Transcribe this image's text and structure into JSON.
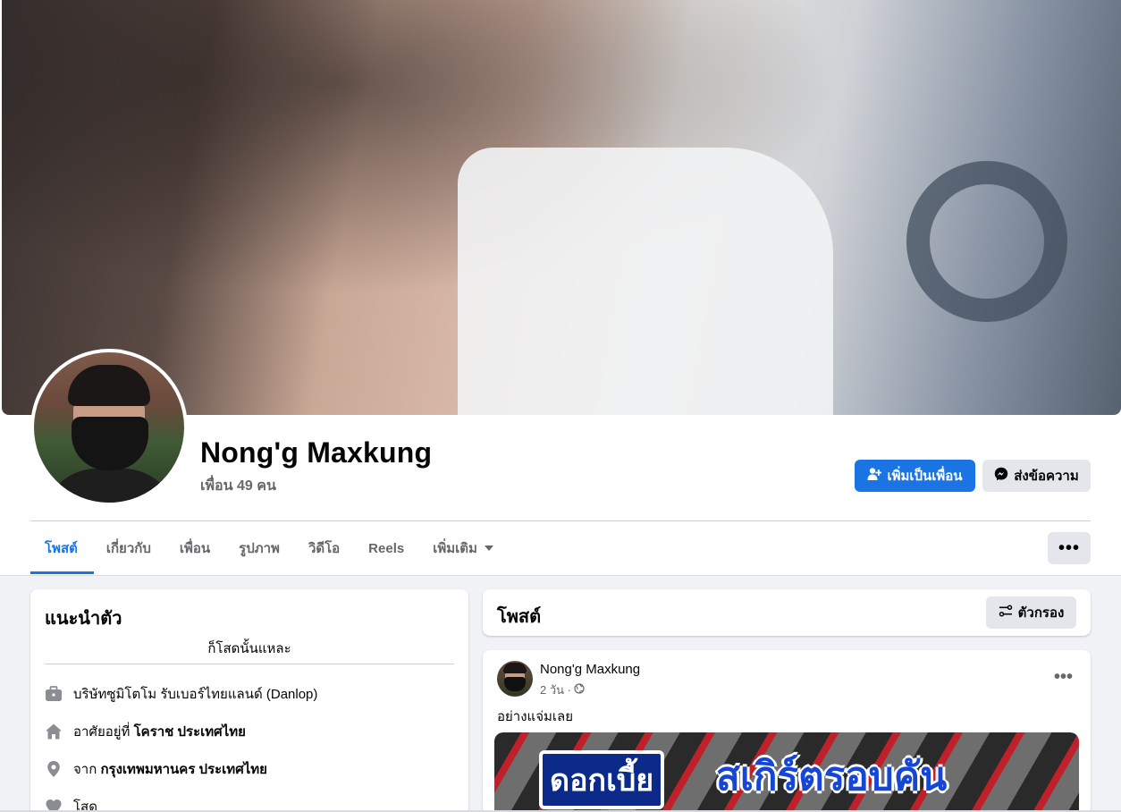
{
  "profile": {
    "name": "Nong'g Maxkung",
    "friends": "เพื่อน 49 คน",
    "add_friend_label": "เพิ่มเป็นเพื่อน",
    "message_label": "ส่งข้อความ"
  },
  "tabs": [
    {
      "label": "โพสต์",
      "active": true
    },
    {
      "label": "เกี่ยวกับ"
    },
    {
      "label": "เพื่อน"
    },
    {
      "label": "รูปภาพ"
    },
    {
      "label": "วิดีโอ"
    },
    {
      "label": "Reels"
    },
    {
      "label": "เพิ่มเติม"
    }
  ],
  "more_label": "•••",
  "intro": {
    "title": "แนะนำตัว",
    "bio": "ก็โสดนั้นแหละ",
    "work": "บริษัทซูมิโตโม รับเบอร์ไทยแลนด์ (Danlop)",
    "lives_prefix": "อาศัยอยู่ที่",
    "lives_place": "โคราช ประเทศไทย",
    "from_prefix": "จาก",
    "from_place": "กรุงเทพมหานคร ประเทศไทย",
    "relationship": "โสด"
  },
  "posts": {
    "title": "โพสต์",
    "filter_label": "ตัวกรอง",
    "first": {
      "author": "Nong'g Maxkung",
      "time": "2 วัน ·",
      "text": "อย่างแจ่มเลย",
      "image_text_1": "ดอกเบี้ย",
      "image_text_2": "สเกิร์ตรอบคัน"
    }
  },
  "colors": {
    "accent": "#1b74e4",
    "secondary_button": "#e4e6eb",
    "page_bg": "#f0f2f5",
    "muted_text": "#65676b"
  }
}
